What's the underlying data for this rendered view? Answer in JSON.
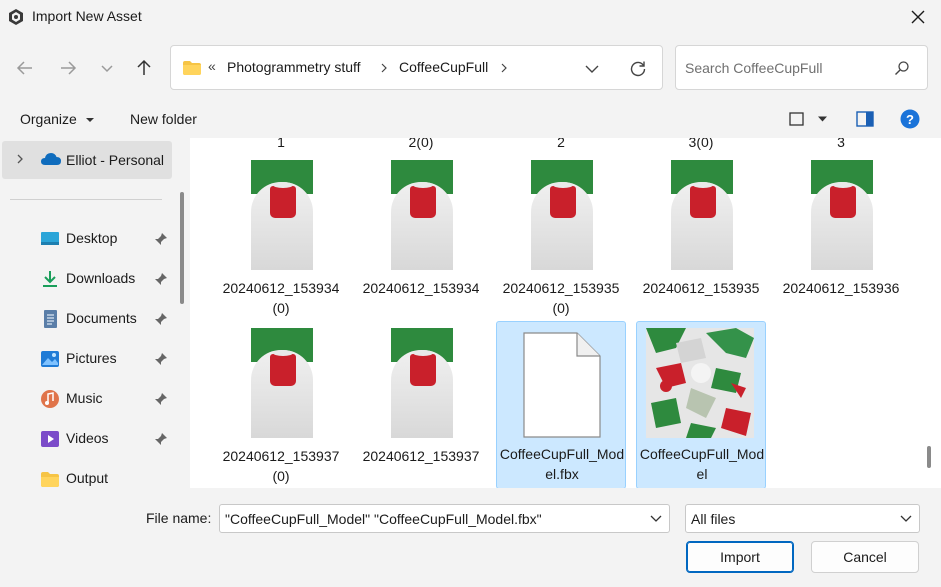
{
  "window": {
    "title": "Import New Asset"
  },
  "address": {
    "overflow": "«",
    "crumbs": [
      "Photogrammetry stuff",
      "CoffeeCupFull"
    ]
  },
  "search": {
    "placeholder": "Search CoffeeCupFull"
  },
  "toolbar": {
    "organize": "Organize",
    "new_folder": "New folder"
  },
  "sidebar": {
    "cloud": "Elliot - Personal",
    "items": [
      {
        "label": "Desktop",
        "icon": "desktop-icon"
      },
      {
        "label": "Downloads",
        "icon": "downloads-icon"
      },
      {
        "label": "Documents",
        "icon": "documents-icon"
      },
      {
        "label": "Pictures",
        "icon": "pictures-icon"
      },
      {
        "label": "Music",
        "icon": "music-icon"
      },
      {
        "label": "Videos",
        "icon": "videos-icon"
      },
      {
        "label": "Output",
        "icon": "folder-icon"
      }
    ]
  },
  "files": {
    "above_row": [
      "1",
      "2(0)",
      "2",
      "3(0)",
      "3"
    ],
    "row1": [
      "20240612_153934(0)",
      "20240612_153934",
      "20240612_153935(0)",
      "20240612_153935",
      "20240612_153936"
    ],
    "row2": [
      "20240612_153937(0)",
      "20240612_153937",
      "CoffeeCupFull_Model.fbx",
      "CoffeeCupFull_Model"
    ]
  },
  "bottom": {
    "filename_label": "File name:",
    "filename_value": "\"CoffeeCupFull_Model\" \"CoffeeCupFull_Model.fbx\"",
    "filetype_value": "All files",
    "import_label": "Import",
    "cancel_label": "Cancel"
  },
  "colors": {
    "accent": "#0067c0",
    "selection": "#cce8ff",
    "selection_border": "#99d1ff",
    "help": "#1a73d9"
  }
}
